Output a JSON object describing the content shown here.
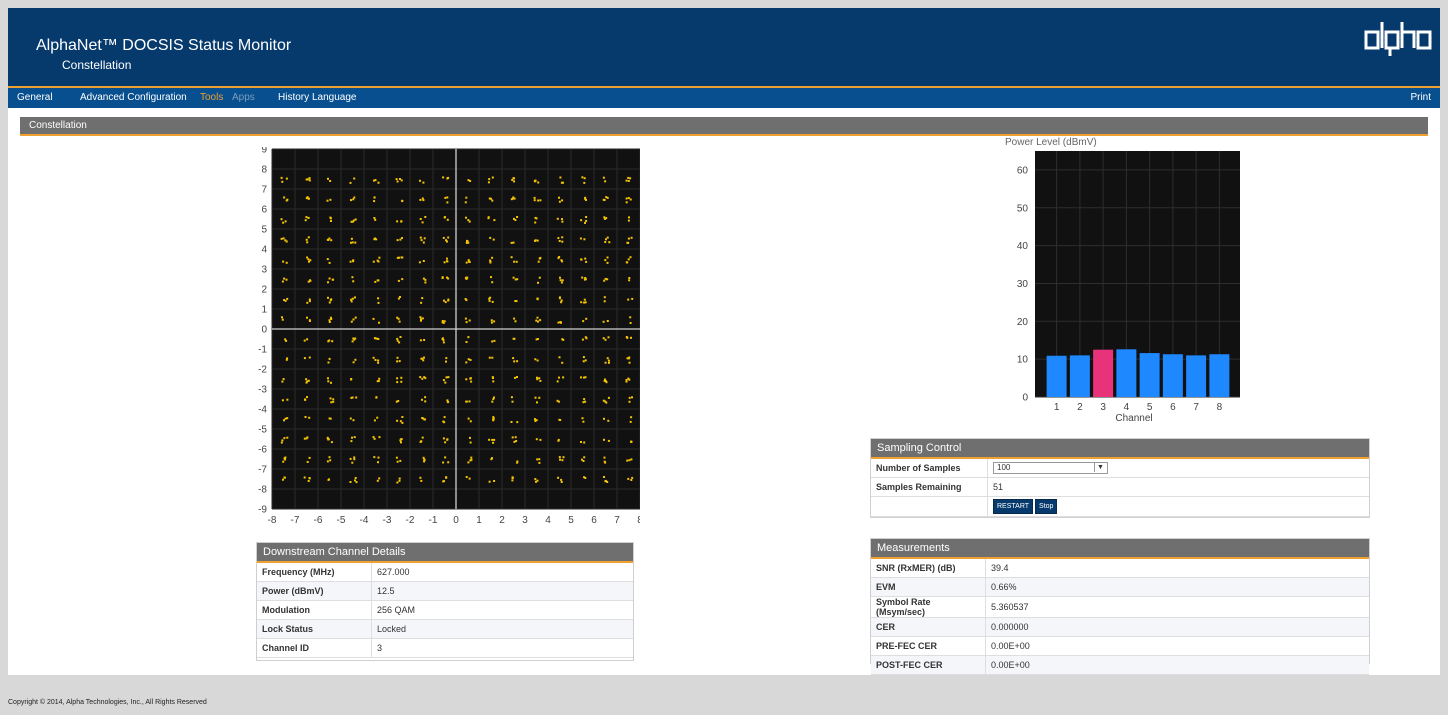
{
  "header": {
    "app_title": "AlphaNet™ DOCSIS Status Monitor",
    "page_subtitle": "Constellation",
    "logo_icon": "alpha-logo-icon"
  },
  "nav": {
    "items": [
      "General",
      "Advanced Configuration",
      "Tools",
      "Apps",
      "History",
      "Language"
    ],
    "active": "Tools",
    "disabled": [
      "Apps"
    ],
    "print_label": "Print"
  },
  "section": {
    "title": "Constellation"
  },
  "constellation": {
    "type": "scatter",
    "xlim": [
      -8,
      8
    ],
    "ylim": [
      -9,
      9
    ],
    "x_ticks": [
      "-8",
      "-7",
      "-6",
      "-5",
      "-4",
      "-3",
      "-2",
      "-1",
      "0",
      "1",
      "2",
      "3",
      "4",
      "5",
      "6",
      "7",
      "8"
    ],
    "y_ticks": [
      "9",
      "8",
      "7",
      "6",
      "5",
      "4",
      "3",
      "2",
      "1",
      "0",
      "-1",
      "-2",
      "-3",
      "-4",
      "-5",
      "-6",
      "-7",
      "-8",
      "-9"
    ],
    "point_color": "#f5c400",
    "modulation": "256 QAM",
    "grid_levels": [
      -7.5,
      -6.5,
      -5.5,
      -4.5,
      -3.5,
      -2.5,
      -1.5,
      -0.5,
      0.5,
      1.5,
      2.5,
      3.5,
      4.5,
      5.5,
      6.5,
      7.5
    ]
  },
  "power_chart": {
    "type": "bar",
    "title": "Power Level (dBmV)",
    "xlabel": "Channel",
    "categories": [
      "1",
      "2",
      "3",
      "4",
      "5",
      "6",
      "7",
      "8"
    ],
    "values": [
      10.9,
      11.0,
      12.5,
      12.6,
      11.6,
      11.3,
      11.0,
      11.3
    ],
    "highlight_index": 2,
    "ylim": [
      0,
      65
    ],
    "y_ticks": [
      "0",
      "10",
      "20",
      "30",
      "40",
      "50",
      "60"
    ],
    "bar_color": "#1e88ff",
    "highlight_color": "#e8337a"
  },
  "downstream": {
    "title": "Downstream Channel Details",
    "rows": [
      {
        "label": "Frequency (MHz)",
        "value": "627.000"
      },
      {
        "label": "Power (dBmV)",
        "value": "12.5"
      },
      {
        "label": "Modulation",
        "value": "256 QAM"
      },
      {
        "label": "Lock Status",
        "value": "Locked"
      },
      {
        "label": "Channel ID",
        "value": "3"
      }
    ]
  },
  "sampling": {
    "title": "Sampling Control",
    "samples_label": "Number of Samples",
    "samples_value": "100",
    "remaining_label": "Samples Remaining",
    "remaining_value": "51",
    "restart_label": "RESTART",
    "stop_label": "Stop"
  },
  "measurements": {
    "title": "Measurements",
    "rows": [
      {
        "label": "SNR (RxMER) (dB)",
        "value": "39.4"
      },
      {
        "label": "EVM",
        "value": "0.66%"
      },
      {
        "label": "Symbol Rate (Msym/sec)",
        "value": "5.360537"
      },
      {
        "label": "CER",
        "value": "0.000000"
      },
      {
        "label": "PRE-FEC CER",
        "value": "0.00E+00"
      },
      {
        "label": "POST-FEC CER",
        "value": "0.00E+00"
      }
    ]
  },
  "footer": {
    "copyright": "Copyright © 2014, Alpha Technologies, Inc., All Rights Reserved"
  }
}
